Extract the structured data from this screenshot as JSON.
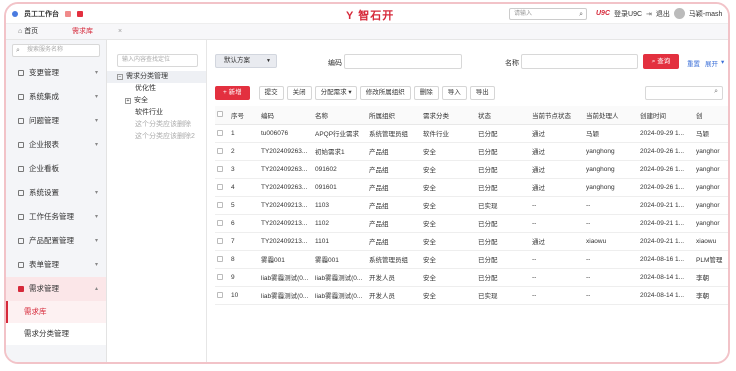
{
  "topbar": {
    "app_title": "员工工作台",
    "logo": "Y 智石开",
    "search_placeholder": "请输入",
    "u9c": "U9C",
    "login_u9c": "登录U9C",
    "logout": "退出",
    "username": "马颖-mash"
  },
  "tabs": [
    {
      "label": "首页"
    },
    {
      "label": "需求库"
    }
  ],
  "sidebar": {
    "search_placeholder": "搜索服务名称",
    "items": [
      {
        "label": "变更管理"
      },
      {
        "label": "系统集成"
      },
      {
        "label": "问题管理"
      },
      {
        "label": "企业报表"
      },
      {
        "label": "企业看板"
      },
      {
        "label": "系统设置"
      },
      {
        "label": "工作任务管理"
      },
      {
        "label": "产品配置管理"
      },
      {
        "label": "表单管理"
      },
      {
        "label": "需求管理"
      }
    ],
    "sub_items": [
      {
        "label": "需求库"
      },
      {
        "label": "需求分类管理"
      }
    ]
  },
  "tree": {
    "search_placeholder": "输入内容查找定位",
    "nodes": [
      {
        "label": "需求分类管理"
      },
      {
        "label": "优化性"
      },
      {
        "label": "安全"
      },
      {
        "label": "软件行业"
      },
      {
        "label": "这个分类应该删除"
      },
      {
        "label": "这个分类应该删除2"
      }
    ]
  },
  "filter": {
    "scheme": "默认方案",
    "code_label": "编码",
    "name_label": "名称",
    "query": "查询",
    "reset": "重置",
    "expand": "展开"
  },
  "toolbar": {
    "new": "+ 新增",
    "submit": "提交",
    "close": "关闭",
    "assign": "分配需求",
    "edit_org": "修改所属组织",
    "delete": "删除",
    "import": "导入",
    "export": "导出"
  },
  "table": {
    "headers": [
      "序号",
      "编码",
      "名称",
      "所属组织",
      "需求分类",
      "状态",
      "当前节点状态",
      "当前处理人",
      "创建时间",
      "创"
    ],
    "rows": [
      [
        "1",
        "tu006076",
        "APQP行业需求",
        "系统管理员组",
        "软件行业",
        "已分配",
        "通过",
        "马颖",
        "2024-09-29 1...",
        "马颖"
      ],
      [
        "2",
        "TY202409263...",
        "初始需求1",
        "产品组",
        "安全",
        "已分配",
        "通过",
        "yanghong",
        "2024-09-26 1...",
        "yanghor"
      ],
      [
        "3",
        "TY202409263...",
        "091602",
        "产品组",
        "安全",
        "已分配",
        "通过",
        "yanghong",
        "2024-09-26 1...",
        "yanghor"
      ],
      [
        "4",
        "TY202409263...",
        "091601",
        "产品组",
        "安全",
        "已分配",
        "通过",
        "yanghong",
        "2024-09-26 1...",
        "yanghor"
      ],
      [
        "5",
        "TY202409213...",
        "1103",
        "产品组",
        "安全",
        "已实现",
        "--",
        "--",
        "2024-09-21 1...",
        "yanghor"
      ],
      [
        "6",
        "TY202409213...",
        "1102",
        "产品组",
        "安全",
        "已分配",
        "--",
        "--",
        "2024-09-21 1...",
        "yanghor"
      ],
      [
        "7",
        "TY202409213...",
        "1101",
        "产品组",
        "安全",
        "已分配",
        "通过",
        "xiaowu",
        "2024-09-21 1...",
        "xiaowu"
      ],
      [
        "8",
        "雾霾001",
        "雾霾001",
        "系统管理员组",
        "安全",
        "已分配",
        "--",
        "--",
        "2024-08-16 1...",
        "PLM管理"
      ],
      [
        "9",
        "liab雾霾测试(0...",
        "liab雾霾测试(0...",
        "开发人员",
        "安全",
        "已分配",
        "--",
        "--",
        "2024-08-14 1...",
        "李朝"
      ],
      [
        "10",
        "liab雾霾测试(0...",
        "liab雾霾测试(0...",
        "开发人员",
        "安全",
        "已实现",
        "--",
        "--",
        "2024-08-14 1...",
        "李朝"
      ]
    ]
  },
  "colors": {
    "accent": "#e3303f",
    "link": "#3b6fd8"
  }
}
